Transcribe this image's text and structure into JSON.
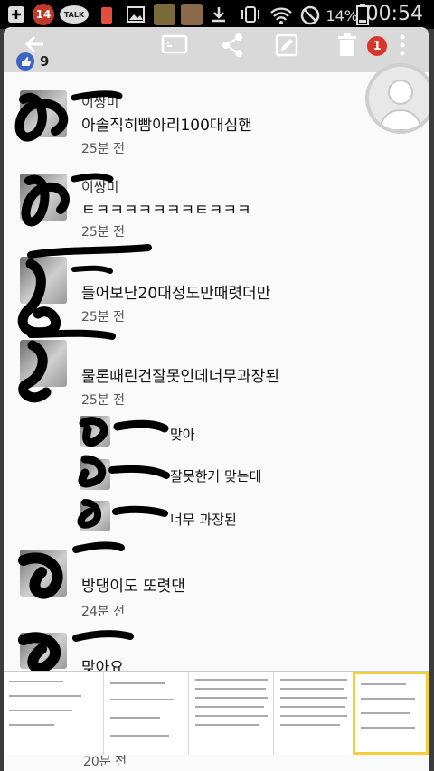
{
  "statusbar": {
    "notif_count": "14",
    "talk_label": "TALK",
    "battery_pct": "14%",
    "time": "00:54",
    "icons": [
      "add-icon",
      "notification-count-icon",
      "talk-icon",
      "battery-app-icon",
      "image-icon",
      "thumbnail-icon",
      "thumbnail-icon",
      "download-icon",
      "vibrate-icon",
      "wifi-icon",
      "block-icon",
      "battery-icon"
    ]
  },
  "toolbar": {
    "badge": "1",
    "icons": [
      "back-arrow-icon",
      "cast-icon",
      "share-icon",
      "edit-icon",
      "delete-icon",
      "more-icon"
    ]
  },
  "likes": {
    "count": "9"
  },
  "comments": [
    {
      "name": "이쌍미",
      "text": "아솔직히빰아리100대심핸",
      "time": "25분 전"
    },
    {
      "name": "이쌍미",
      "text": "ㅌㅋㅋㅋㅋㅋㅋㅋㅌㅋㅋㅋ",
      "time": "25분 전"
    },
    {
      "name": "",
      "text": "들어보난20대정도만때렷더만",
      "time": "25분 전"
    },
    {
      "name": "",
      "text": "물론때린건잘못인데너무과장된",
      "time": "25분 전"
    },
    {
      "name": "",
      "text": "맞아",
      "time": ""
    },
    {
      "name": "",
      "text": "잘못한거 맞는데",
      "time": ""
    },
    {
      "name": "",
      "text": "너무 과장된",
      "time": ""
    },
    {
      "name": "",
      "text": "방댕이도 또렷댄",
      "time": "24분 전"
    },
    {
      "name": "",
      "text": "맞아요",
      "time": ""
    }
  ],
  "bottom_time": "20분 전",
  "colors": {
    "badge": "#d9362b",
    "toolbar": "#d9d9d9",
    "like_blue": "#3b66c4",
    "thumb_highlight": "#f2cf38"
  }
}
